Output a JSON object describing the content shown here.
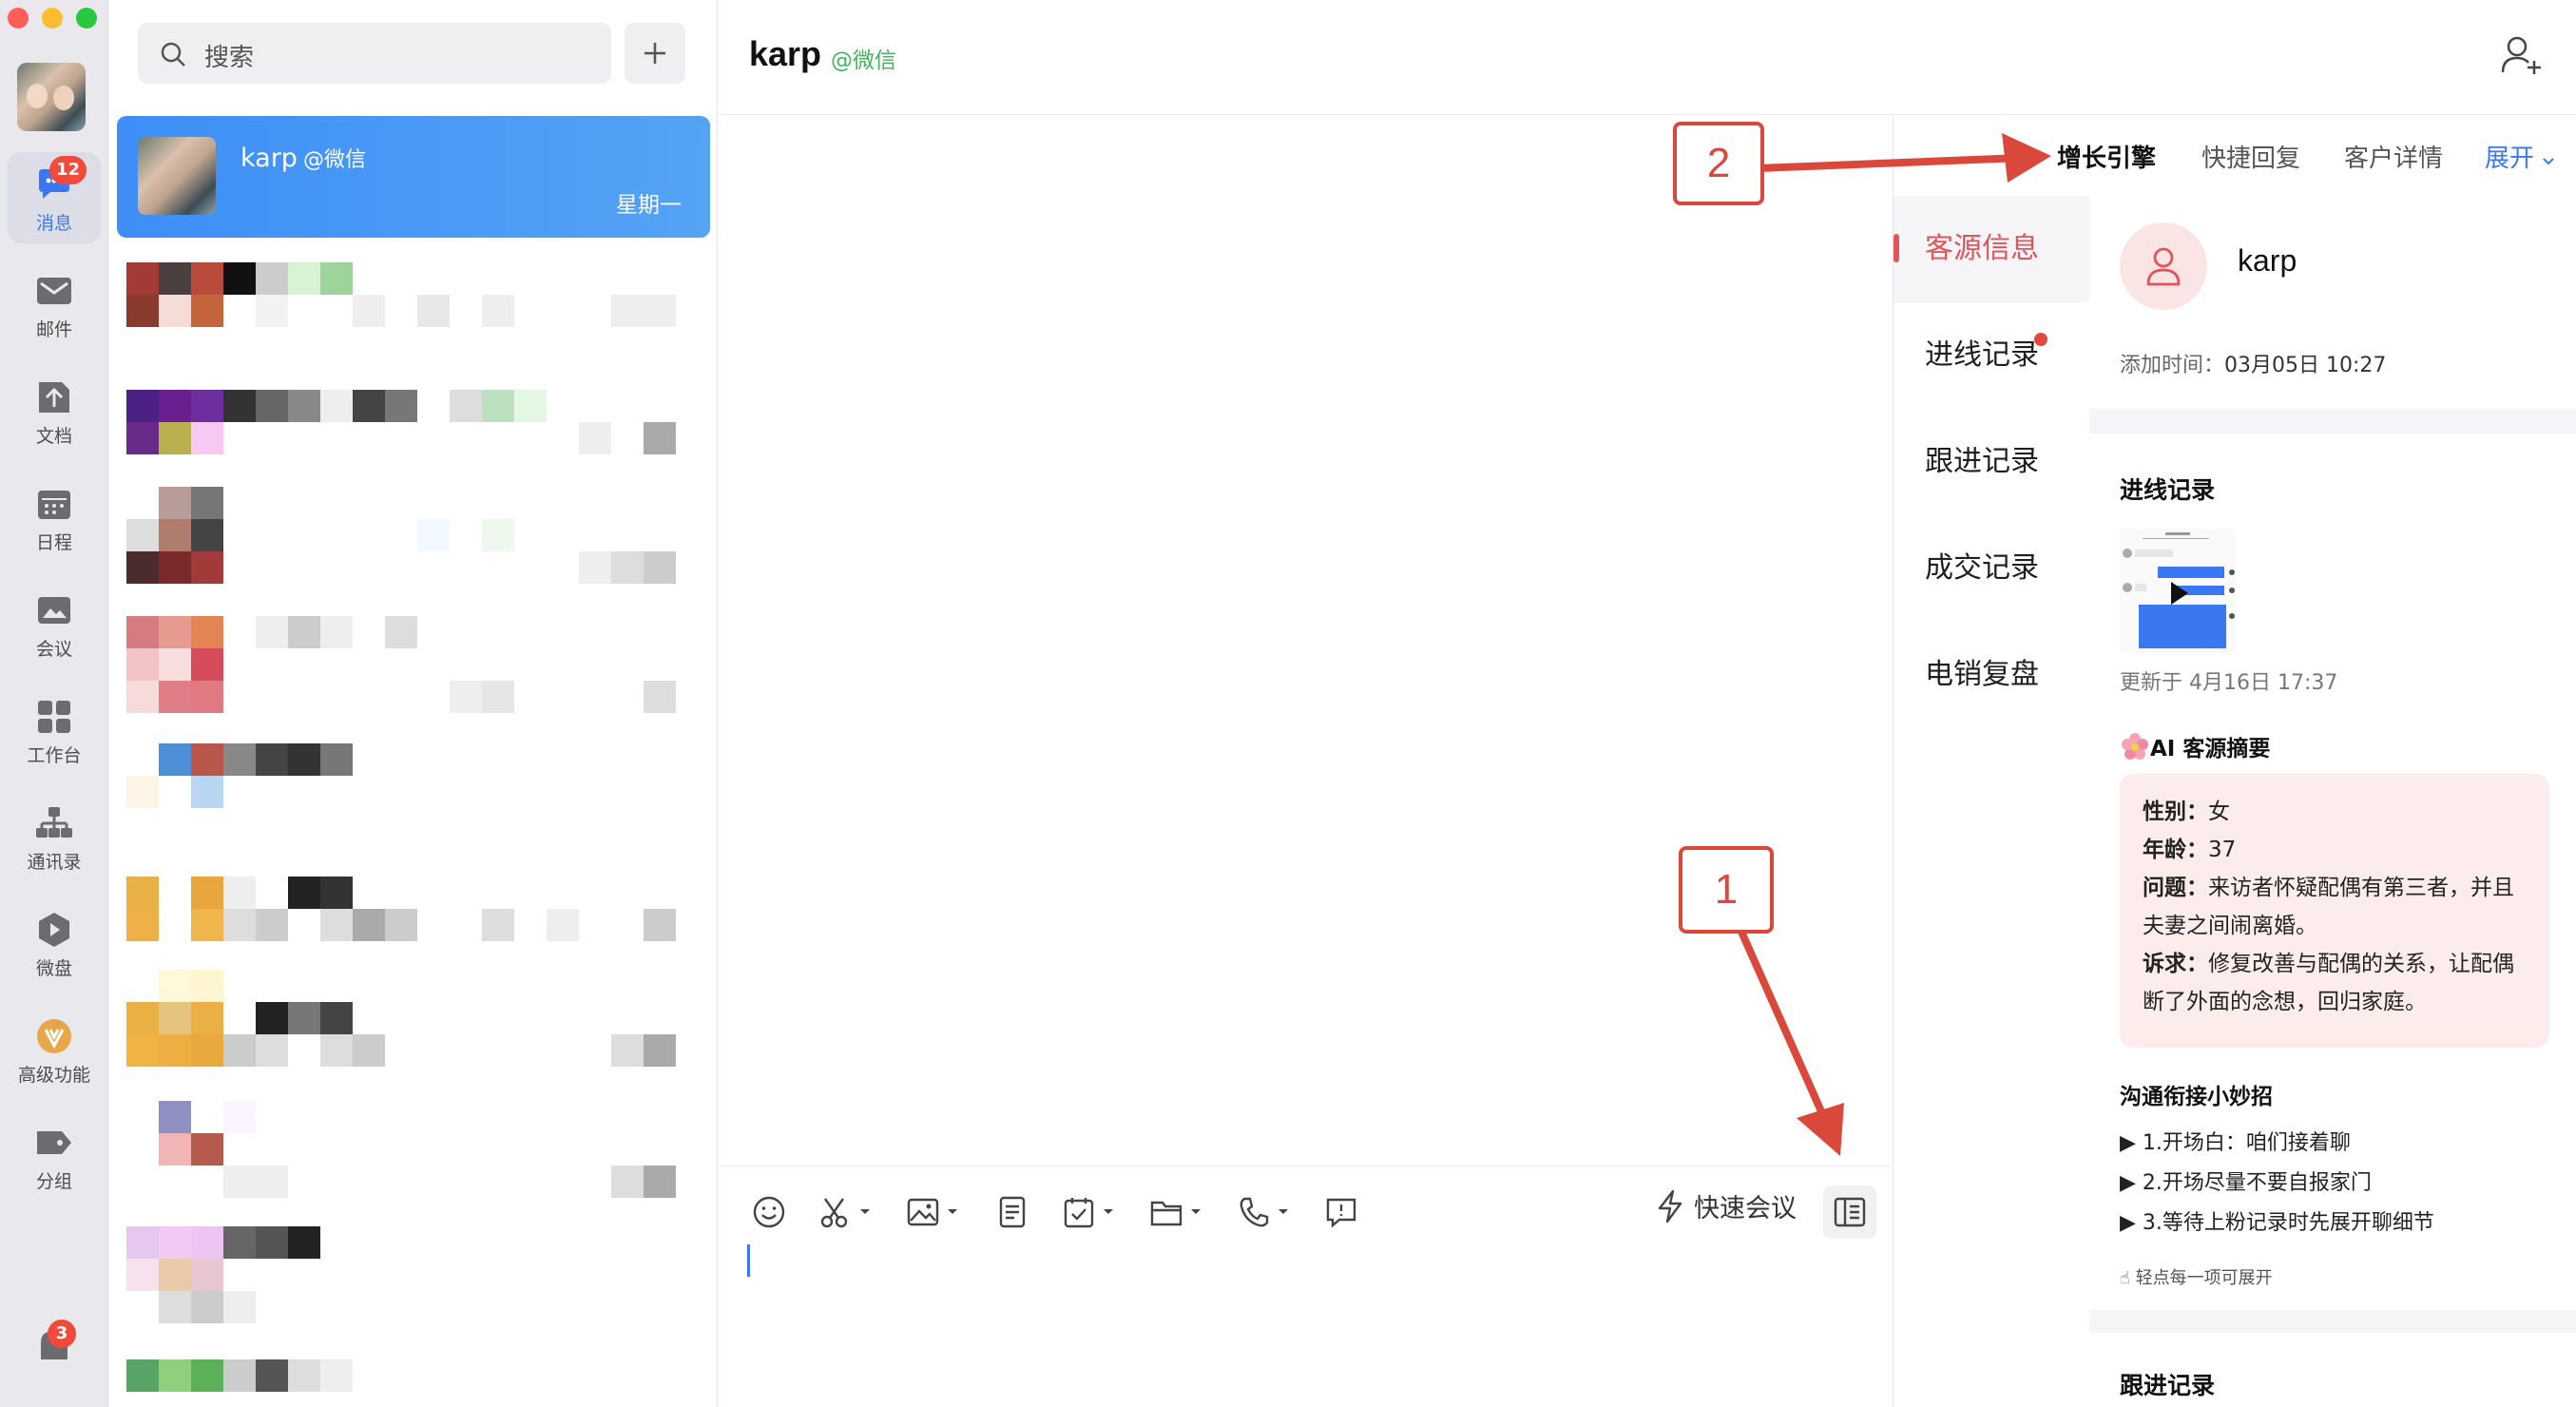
{
  "rail": {
    "nav": [
      {
        "id": "messages",
        "label": "消息",
        "badge": "12"
      },
      {
        "id": "mail",
        "label": "邮件"
      },
      {
        "id": "docs",
        "label": "文档"
      },
      {
        "id": "schedule",
        "label": "日程"
      },
      {
        "id": "meeting",
        "label": "会议"
      },
      {
        "id": "workbench",
        "label": "工作台"
      },
      {
        "id": "contacts",
        "label": "通讯录"
      },
      {
        "id": "drive",
        "label": "微盘"
      },
      {
        "id": "premium",
        "label": "高级功能"
      },
      {
        "id": "groups",
        "label": "分组"
      }
    ],
    "bottom_badge": "3"
  },
  "list": {
    "search_placeholder": "搜索",
    "active": {
      "name": "karp",
      "tag": "@微信",
      "time": "星期一"
    }
  },
  "chat": {
    "title": "karp",
    "tag": "@微信",
    "quick_meeting": "快速会议"
  },
  "panel": {
    "tabs": [
      {
        "label": "增长引擎",
        "active": true
      },
      {
        "label": "快捷回复"
      },
      {
        "label": "客户详情"
      },
      {
        "label": "展开"
      }
    ],
    "vnav": [
      {
        "label": "客源信息",
        "active": true
      },
      {
        "label": "进线记录",
        "dot": true
      },
      {
        "label": "跟进记录"
      },
      {
        "label": "成交记录"
      },
      {
        "label": "电销复盘"
      }
    ],
    "profile": {
      "name": "karp",
      "added_label": "添加时间：",
      "added_value": "03月05日 10:27"
    },
    "inbound": {
      "title": "进线记录",
      "updated": "更新于 4月16日 17:37"
    },
    "ai": {
      "title": "AI 客源摘要",
      "gender_label": "性别：",
      "gender": "女",
      "age_label": "年龄：",
      "age": "37",
      "issue_label": "问题：",
      "issue": "来访者怀疑配偶有第三者，并且夫妻之间闹离婚。",
      "demand_label": "诉求：",
      "demand": "修复改善与配偶的关系，让配偶断了外面的念想，回归家庭。"
    },
    "tips": {
      "title": "沟通衔接小妙招",
      "items": [
        "▶ 1.开场白：咱们接着聊",
        "▶ 2.开场尽量不要自报家门",
        "▶ 3.等待上粉记录时先展开聊细节"
      ],
      "hint": "☝ 轻点每一项可展开"
    },
    "follow_title": "跟进记录"
  },
  "annotations": {
    "one": "1",
    "two": "2"
  },
  "colors": {
    "accent": "#3a78f2",
    "brand_red": "#e0545a",
    "annotation": "#d9483b",
    "wechat_green": "#3fb55b"
  }
}
